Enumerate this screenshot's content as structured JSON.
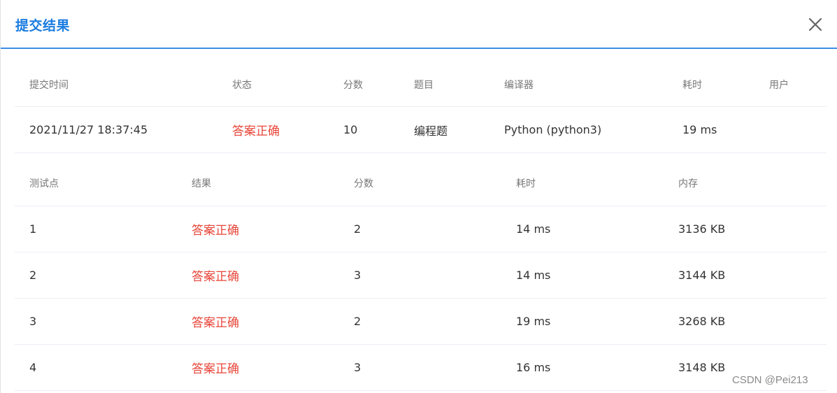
{
  "dialog": {
    "title": "提交结果"
  },
  "summary": {
    "columns": [
      "提交时间",
      "状态",
      "分数",
      "题目",
      "编译器",
      "耗时",
      "用户"
    ],
    "row": {
      "time": "2021/11/27 18:37:45",
      "status": "答案正确",
      "score": "10",
      "problem": "编程题",
      "compiler": "Python (python3)",
      "duration": "19 ms",
      "user": ""
    }
  },
  "tests": {
    "columns": [
      "测试点",
      "结果",
      "分数",
      "耗时",
      "内存"
    ],
    "rows": [
      {
        "id": "1",
        "result": "答案正确",
        "score": "2",
        "duration": "14 ms",
        "memory": "3136 KB"
      },
      {
        "id": "2",
        "result": "答案正确",
        "score": "3",
        "duration": "14 ms",
        "memory": "3144 KB"
      },
      {
        "id": "3",
        "result": "答案正确",
        "score": "2",
        "duration": "19 ms",
        "memory": "3268 KB"
      },
      {
        "id": "4",
        "result": "答案正确",
        "score": "3",
        "duration": "16 ms",
        "memory": "3148 KB"
      }
    ]
  },
  "colors": {
    "title": "#1a7ce0",
    "accent_border": "#3a8ee6",
    "status_ok": "#e8463a"
  },
  "watermark": "CSDN @Pei213"
}
